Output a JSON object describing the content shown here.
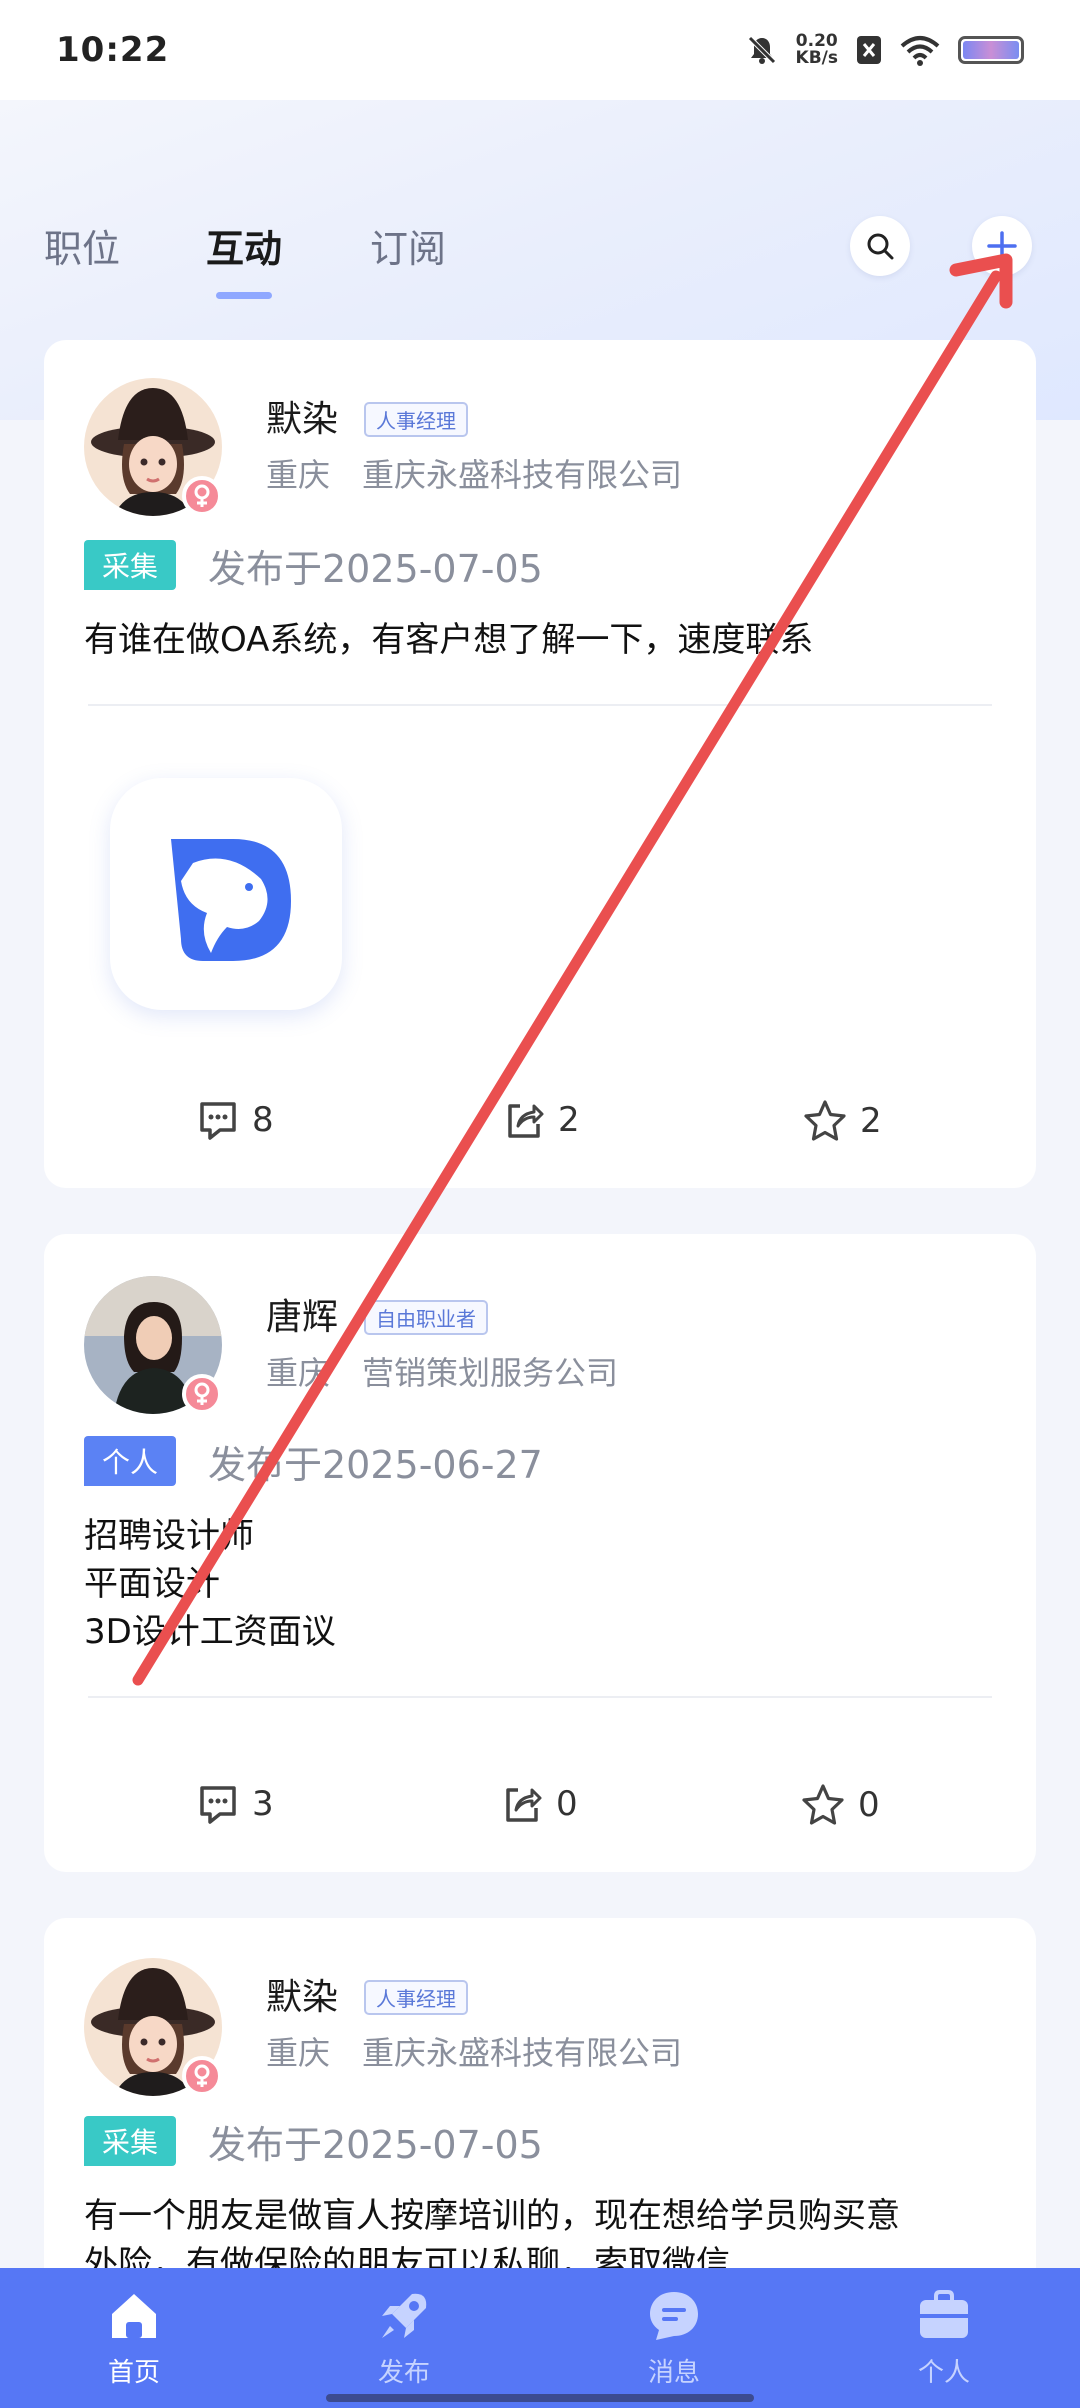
{
  "status_bar": {
    "time": "10:22",
    "net_speed_value": "0.20",
    "net_speed_unit": "KB/s",
    "icons": [
      "mute-icon",
      "net-speed",
      "no-sim-icon",
      "wifi-icon",
      "battery-icon"
    ]
  },
  "tabs": [
    {
      "label": "职位",
      "active": false
    },
    {
      "label": "互动",
      "active": true
    },
    {
      "label": "订阅",
      "active": false
    }
  ],
  "header_icons": [
    "search-icon",
    "plus-icon"
  ],
  "posts": [
    {
      "author": "默染",
      "role": "人事经理",
      "city": "重庆",
      "company": "重庆永盛科技有限公司",
      "source_tag": "采集",
      "date": "发布于2025-07-05",
      "text": "有谁在做OA系统，有客户想了解一下，速度联系",
      "has_image": true,
      "comments": "8",
      "shares": "2",
      "stars": "2"
    },
    {
      "author": "唐辉",
      "role": "自由职业者",
      "city": "重庆",
      "company": "营销策划服务公司",
      "source_tag": "个人",
      "date": "发布于2025-06-27",
      "text": "招聘设计师\n平面设计\n3D设计工资面议",
      "has_image": false,
      "comments": "3",
      "shares": "0",
      "stars": "0"
    },
    {
      "author": "默染",
      "role": "人事经理",
      "city": "重庆",
      "company": "重庆永盛科技有限公司",
      "source_tag": "采集",
      "date": "发布于2025-07-05",
      "text": "有一个朋友是做盲人按摩培训的，现在想给学员购买意\n外险，有做保险的朋友可以私聊，索取微信"
    }
  ],
  "bottom_nav": [
    {
      "label": "首页",
      "icon": "home-icon",
      "active": true
    },
    {
      "label": "发布",
      "icon": "rocket-icon",
      "active": false
    },
    {
      "label": "消息",
      "icon": "message-icon",
      "active": false
    },
    {
      "label": "个人",
      "icon": "briefcase-icon",
      "active": false
    }
  ],
  "colors": {
    "accent": "#5677f5",
    "annotation_arrow": "#ea4f4f",
    "tag_teal": "#39c9c6",
    "tag_blue": "#5b82f4"
  }
}
